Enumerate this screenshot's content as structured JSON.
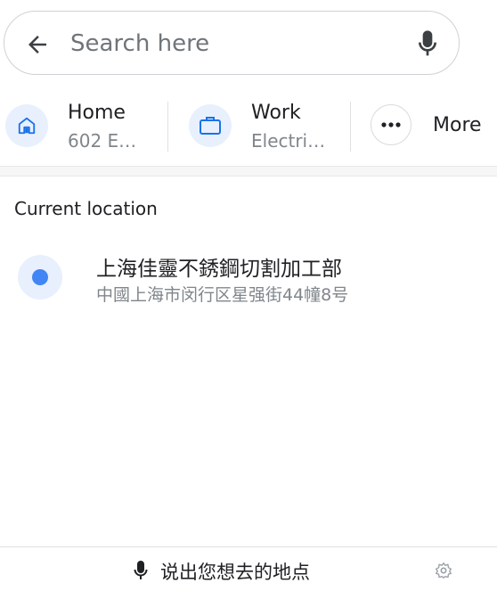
{
  "search": {
    "placeholder": "Search here"
  },
  "chips": [
    {
      "title": "Home",
      "subtitle": "602 E…",
      "icon": "home-icon"
    },
    {
      "title": "Work",
      "subtitle": "Electri…",
      "icon": "briefcase-icon"
    },
    {
      "title": "More",
      "icon": "more-horizontal-icon"
    }
  ],
  "section": {
    "title": "Current location"
  },
  "current_location": {
    "name": "上海佳靈不銹鋼切割加工部",
    "address": "中國上海市闵行区星强街44幢8号"
  },
  "bottom": {
    "voice_label": "说出您想去的地点",
    "mic_icon": "mic-icon",
    "settings_icon": "gear-icon"
  },
  "colors": {
    "accent": "#4285f4",
    "chip_bg": "#e8f0fe",
    "secondary_text": "#80868b"
  }
}
